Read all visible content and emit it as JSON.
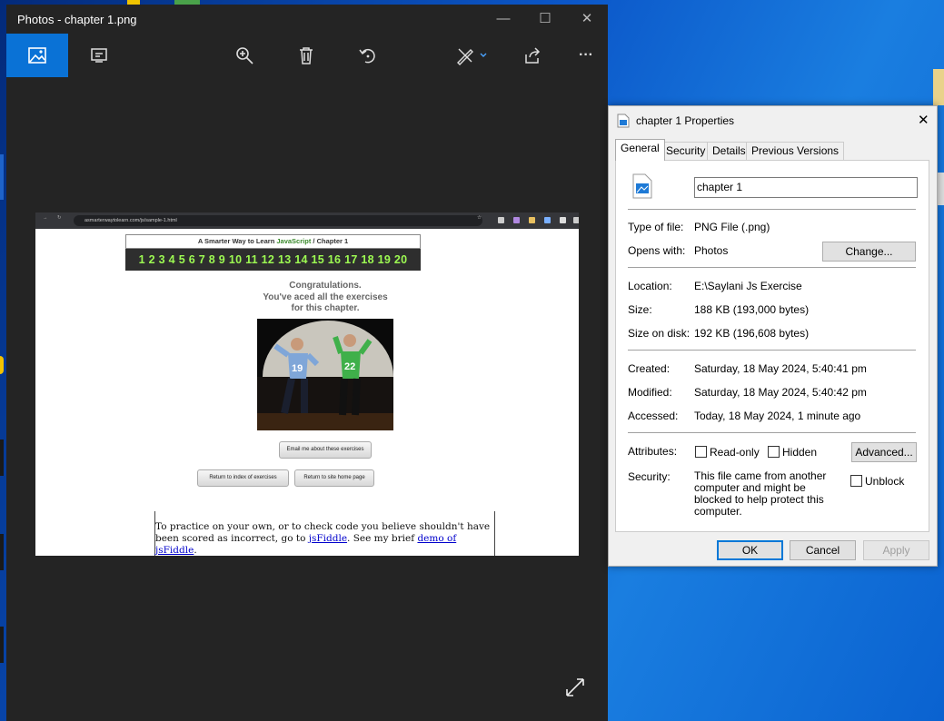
{
  "photos": {
    "title": "Photos - chapter 1.png",
    "window_controls": {
      "minimize": "—",
      "maximize": "☐",
      "close": "✕"
    },
    "toolbar": [
      {
        "name": "view-image",
        "icon": "image-icon"
      },
      {
        "name": "slideshow",
        "icon": "slideshow-icon"
      },
      {
        "name": "zoom",
        "icon": "zoom-in-icon"
      },
      {
        "name": "delete",
        "icon": "trash-icon"
      },
      {
        "name": "rotate",
        "icon": "rotate-icon"
      },
      {
        "name": "edit",
        "icon": "edit-icon"
      },
      {
        "name": "share",
        "icon": "share-icon"
      },
      {
        "name": "more",
        "icon": "more-icon",
        "label": "···"
      }
    ],
    "accent": "#0a72d6"
  },
  "screenshot": {
    "url": "asmarterwaytolearn.com/js/sample-1.html",
    "header": {
      "prefix": "A Smarter Way to Learn ",
      "highlight": "JavaScript",
      "suffix": "  /  Chapter 1"
    },
    "numbers": "1 2 3 4 5 6 7 8 9 10 11 12 13 14 15 16 17 18 19 20",
    "congrats": [
      "Congratulations.",
      "You've aced all the exercises",
      "for this chapter."
    ],
    "jersey_left": "19",
    "jersey_right": "22",
    "buttons": {
      "email": "Email me about these exercises",
      "index": "Return to index of exercises",
      "home": "Return to site home page"
    },
    "fiddle": {
      "text1": "To practice on your own, or to check code you believe shouldn't have been scored as incorrect, go to ",
      "link1": "jsFiddle",
      "text2": ". See my brief ",
      "link2": "demo of jsFiddle",
      "text3": "."
    }
  },
  "properties": {
    "title": "chapter 1 Properties",
    "close": "✕",
    "tabs": [
      "General",
      "Security",
      "Details",
      "Previous Versions"
    ],
    "filename": "chapter 1",
    "type_label": "Type of file:",
    "type_value": "PNG File (.png)",
    "opens_label": "Opens with:",
    "opens_value": "Photos",
    "change_button": "Change...",
    "location_label": "Location:",
    "location_value": "E:\\Saylani Js Exercise",
    "size_label": "Size:",
    "size_value": "188 KB (193,000 bytes)",
    "disk_label": "Size on disk:",
    "disk_value": "192 KB (196,608 bytes)",
    "created_label": "Created:",
    "created_value": "Saturday, 18 May 2024, 5:40:41 pm",
    "modified_label": "Modified:",
    "modified_value": "Saturday, 18 May 2024, 5:40:42 pm",
    "accessed_label": "Accessed:",
    "accessed_value": "Today, 18 May 2024, 1 minute ago",
    "attributes_label": "Attributes:",
    "readonly": "Read-only",
    "hidden": "Hidden",
    "advanced_button": "Advanced...",
    "security_label": "Security:",
    "security_text": "This file came from another computer and might be blocked to help protect this computer.",
    "unblock": "Unblock",
    "ok": "OK",
    "cancel": "Cancel",
    "apply": "Apply"
  }
}
